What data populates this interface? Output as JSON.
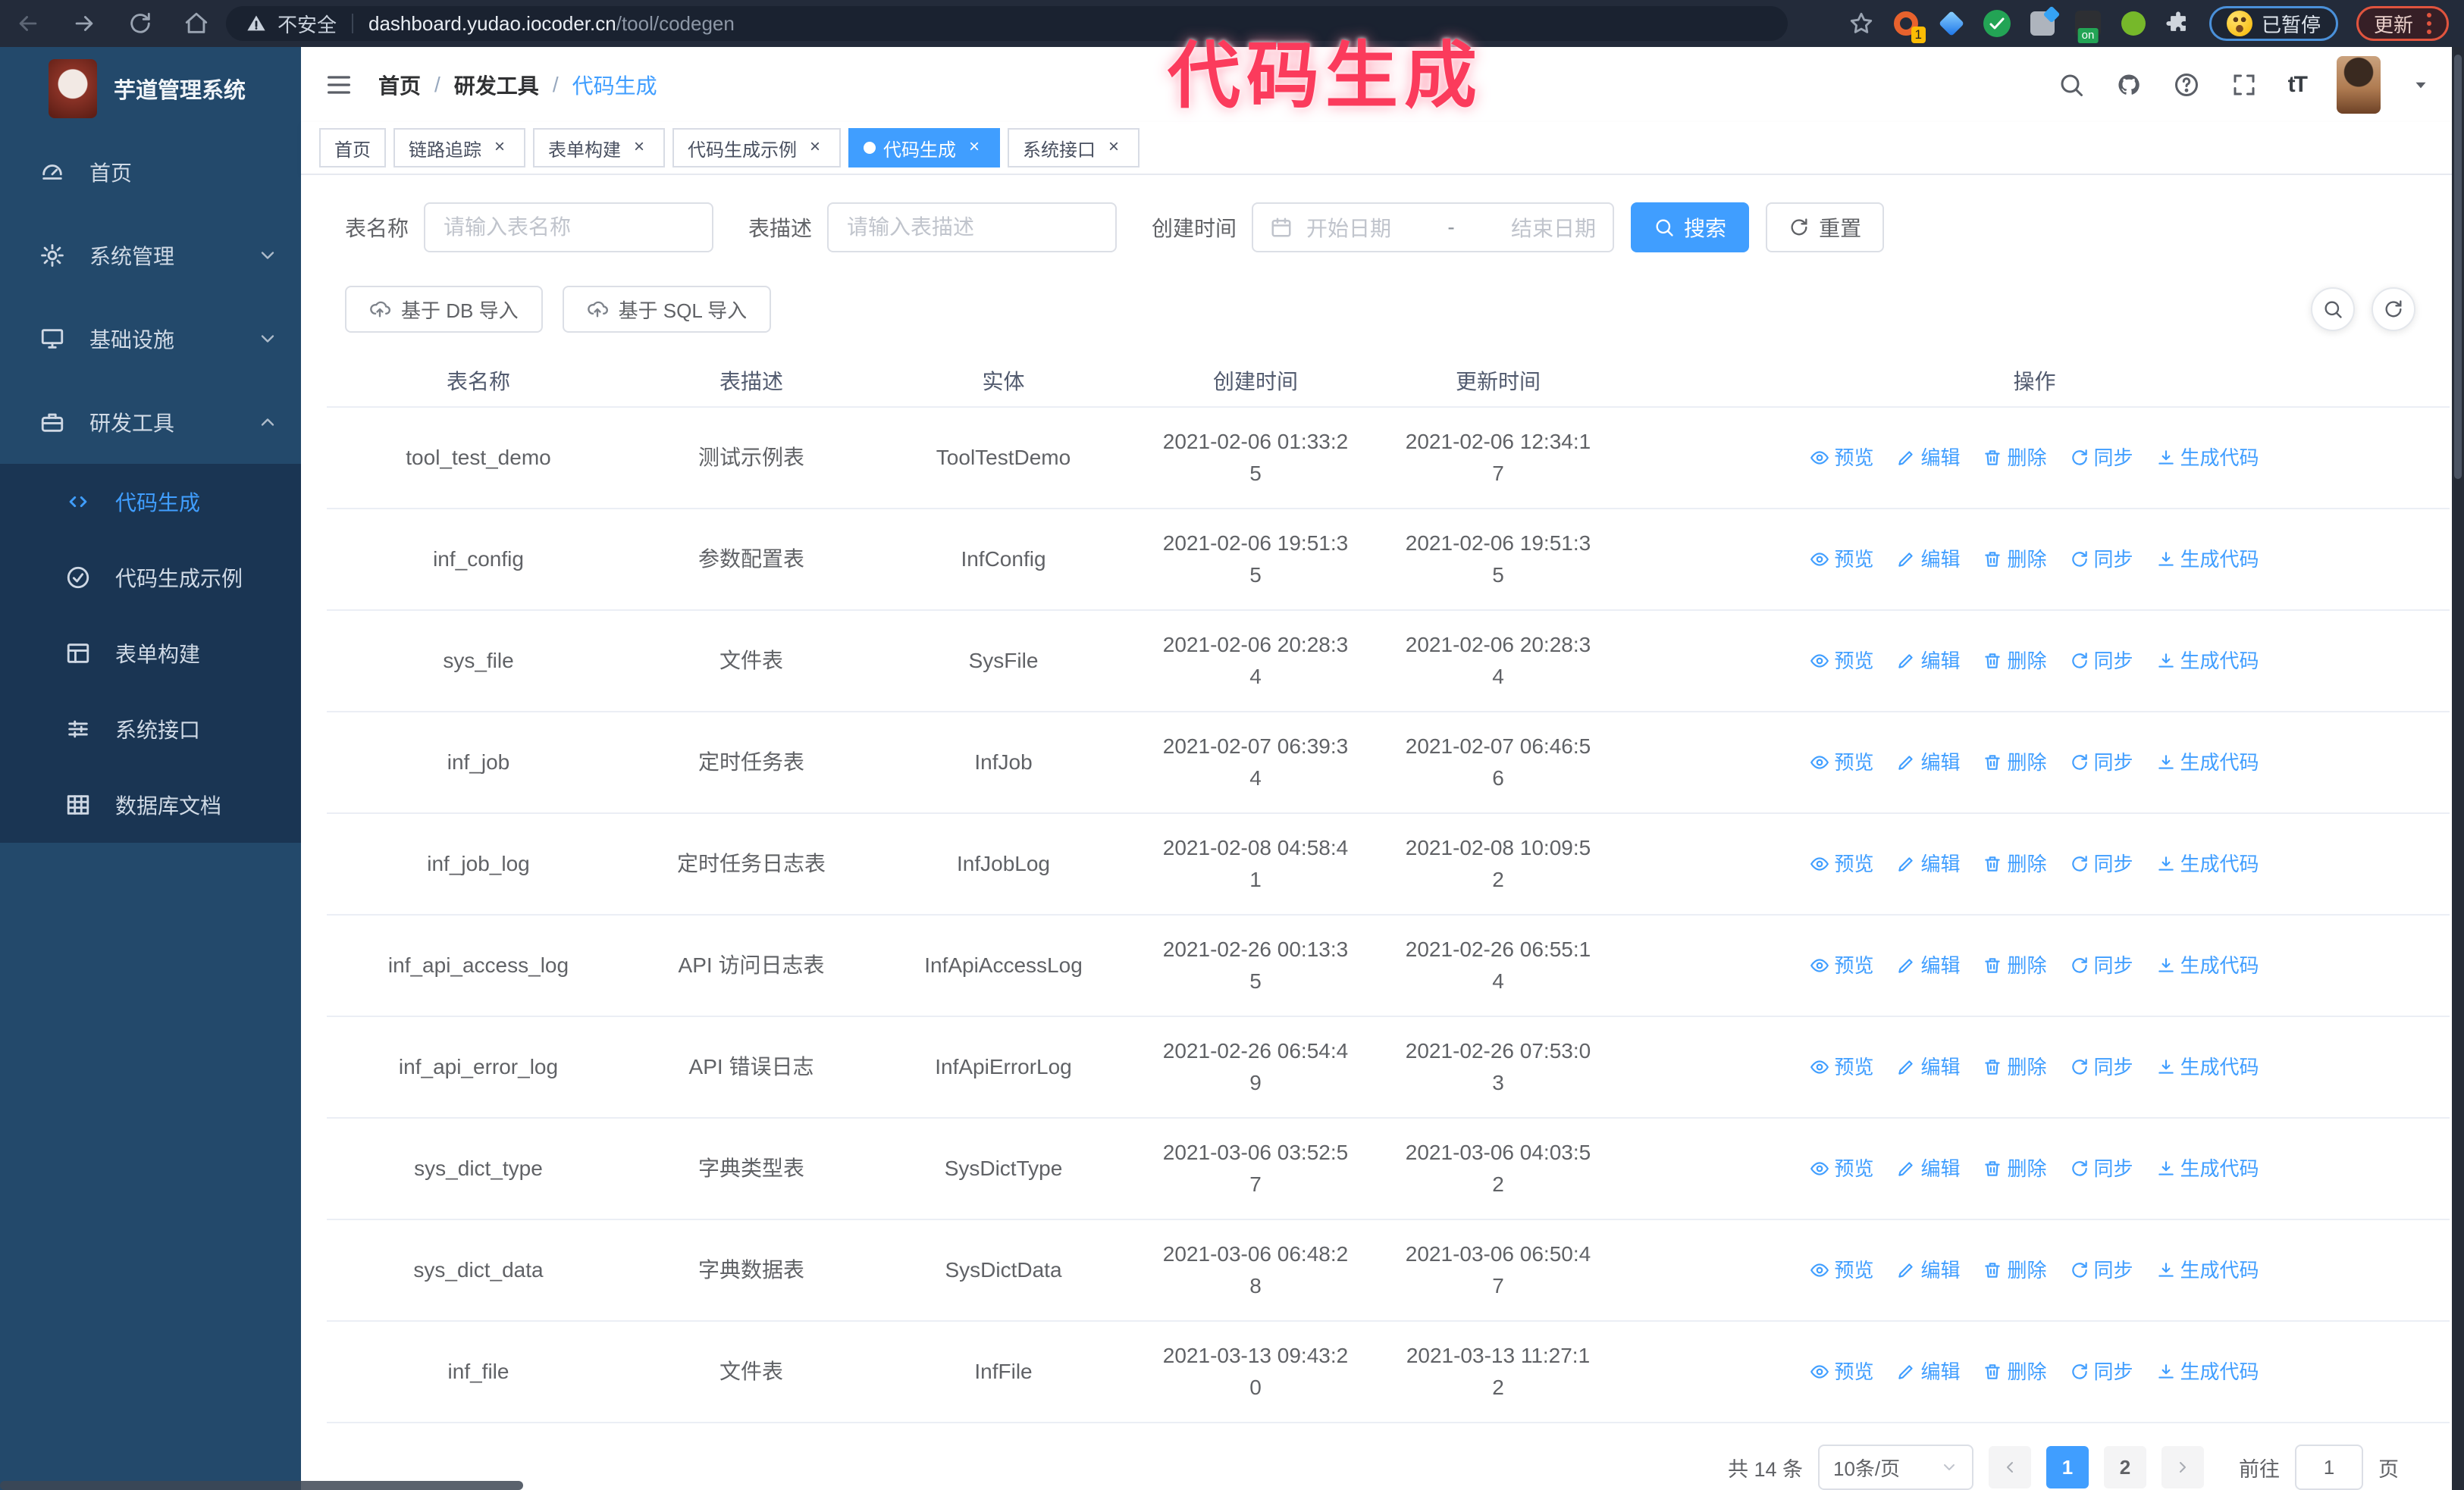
{
  "browser": {
    "security_label": "不安全",
    "url_host": "dashboard.yudao.iocoder.cn",
    "url_path": "/tool/codegen",
    "ext_badge": "1",
    "ext_on_label": "on",
    "paused_badge": "已暂停",
    "update_button": "更新"
  },
  "annotation": {
    "text": "代码生成",
    "color": "#fb3b5c"
  },
  "sidebar": {
    "title": "芋道管理系统",
    "items": [
      {
        "id": "home",
        "icon": "dashboard",
        "label": "首页"
      },
      {
        "id": "system",
        "icon": "gear",
        "label": "系统管理",
        "expandable": true,
        "expanded": false
      },
      {
        "id": "infra",
        "icon": "monitor",
        "label": "基础设施",
        "expandable": true,
        "expanded": false
      },
      {
        "id": "dev-tools",
        "icon": "tool",
        "label": "研发工具",
        "expandable": true,
        "expanded": true,
        "children": [
          {
            "id": "codegen",
            "icon": "code",
            "label": "代码生成",
            "active": true
          },
          {
            "id": "codegen-example",
            "icon": "example",
            "label": "代码生成示例"
          },
          {
            "id": "form-builder",
            "icon": "form",
            "label": "表单构建"
          },
          {
            "id": "system-api",
            "icon": "api",
            "label": "系统接口"
          },
          {
            "id": "db-doc",
            "icon": "db",
            "label": "数据库文档"
          }
        ]
      }
    ]
  },
  "breadcrumb": [
    "首页",
    "研发工具",
    "代码生成"
  ],
  "tabs": [
    {
      "id": "home",
      "label": "首页",
      "closable": false,
      "active": false
    },
    {
      "id": "tracing",
      "label": "链路追踪",
      "closable": true,
      "active": false
    },
    {
      "id": "form-builder",
      "label": "表单构建",
      "closable": true,
      "active": false
    },
    {
      "id": "codegen-example",
      "label": "代码生成示例",
      "closable": true,
      "active": false
    },
    {
      "id": "codegen",
      "label": "代码生成",
      "closable": true,
      "active": true
    },
    {
      "id": "system-api",
      "label": "系统接口",
      "closable": true,
      "active": false
    }
  ],
  "search": {
    "name_label": "表名称",
    "name_placeholder": "请输入表名称",
    "desc_label": "表描述",
    "desc_placeholder": "请输入表描述",
    "time_label": "创建时间",
    "start_placeholder": "开始日期",
    "range_separator": "-",
    "end_placeholder": "结束日期",
    "search_label": "搜索",
    "reset_label": "重置"
  },
  "toolbar": {
    "import_db": "基于 DB 导入",
    "import_sql": "基于 SQL 导入"
  },
  "table": {
    "headers": [
      "表名称",
      "表描述",
      "实体",
      "创建时间",
      "更新时间",
      "操作"
    ],
    "actions": [
      {
        "id": "preview",
        "label": "预览"
      },
      {
        "id": "edit",
        "label": "编辑"
      },
      {
        "id": "delete",
        "label": "删除"
      },
      {
        "id": "sync",
        "label": "同步"
      },
      {
        "id": "generate",
        "label": "生成代码"
      }
    ],
    "rows": [
      [
        "tool_test_demo",
        "测试示例表",
        "ToolTestDemo",
        "2021-02-06 01:33:25",
        "2021-02-06 12:34:17"
      ],
      [
        "inf_config",
        "参数配置表",
        "InfConfig",
        "2021-02-06 19:51:35",
        "2021-02-06 19:51:35"
      ],
      [
        "sys_file",
        "文件表",
        "SysFile",
        "2021-02-06 20:28:34",
        "2021-02-06 20:28:34"
      ],
      [
        "inf_job",
        "定时任务表",
        "InfJob",
        "2021-02-07 06:39:34",
        "2021-02-07 06:46:56"
      ],
      [
        "inf_job_log",
        "定时任务日志表",
        "InfJobLog",
        "2021-02-08 04:58:41",
        "2021-02-08 10:09:52"
      ],
      [
        "inf_api_access_log",
        "API 访问日志表",
        "InfApiAccessLog",
        "2021-02-26 00:13:35",
        "2021-02-26 06:55:14"
      ],
      [
        "inf_api_error_log",
        "API 错误日志",
        "InfApiErrorLog",
        "2021-02-26 06:54:49",
        "2021-02-26 07:53:03"
      ],
      [
        "sys_dict_type",
        "字典类型表",
        "SysDictType",
        "2021-03-06 03:52:57",
        "2021-03-06 04:03:52"
      ],
      [
        "sys_dict_data",
        "字典数据表",
        "SysDictData",
        "2021-03-06 06:48:28",
        "2021-03-06 06:50:47"
      ],
      [
        "inf_file",
        "文件表",
        "InfFile",
        "2021-03-13 09:43:20",
        "2021-03-13 11:27:12"
      ]
    ]
  },
  "pagination": {
    "total": "共 14 条",
    "page_size": "10条/页",
    "pages": [
      "1",
      "2"
    ],
    "active_page": "1",
    "goto_label": "前往",
    "goto_value": "1",
    "page_suffix": "页"
  },
  "colors": {
    "accent": "#409eff",
    "sidebar_bg": "#23496b",
    "submenu_bg": "#1a3553",
    "annotation": "#fb3b5c"
  }
}
